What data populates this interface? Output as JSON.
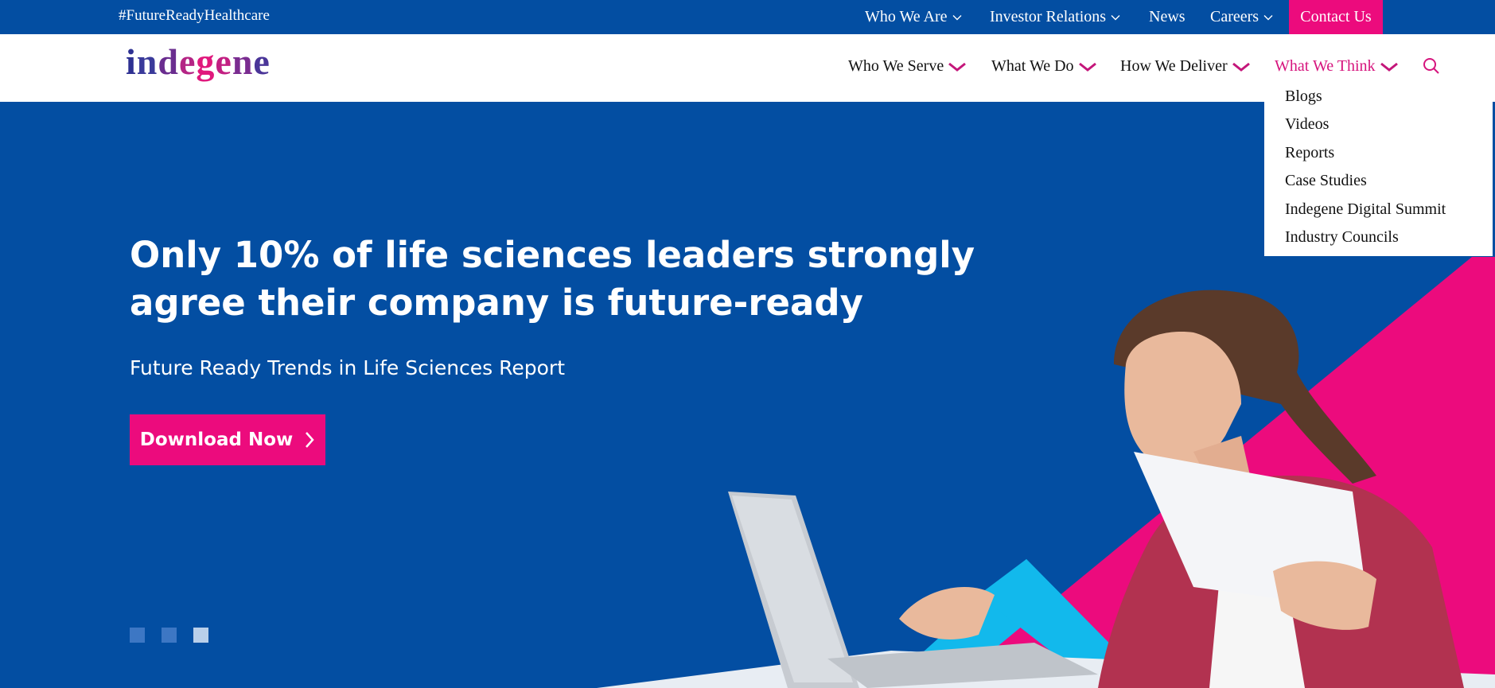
{
  "topbar": {
    "hashtag": "#FutureReadyHealthcare",
    "links": [
      {
        "label": "Who We Are",
        "has_dropdown": true
      },
      {
        "label": "Investor Relations",
        "has_dropdown": true
      },
      {
        "label": "News",
        "has_dropdown": false
      },
      {
        "label": "Careers",
        "has_dropdown": true
      }
    ],
    "contact_label": "Contact Us"
  },
  "header": {
    "logo_text": "indegene",
    "nav": [
      {
        "label": "Who We Serve"
      },
      {
        "label": "What We Do"
      },
      {
        "label": "How We Deliver"
      },
      {
        "label": "What We Think",
        "active": true
      }
    ],
    "search_icon": "search-icon"
  },
  "dropdown": {
    "items": [
      "Blogs",
      "Videos",
      "Reports",
      "Case Studies",
      "Indegene Digital Summit",
      "Industry Councils"
    ]
  },
  "hero": {
    "headline_line1": "Only 10% of life sciences leaders strongly",
    "headline_line2": "agree their company is future-ready",
    "subheadline": "Future Ready Trends in Life Sciences Report",
    "cta_label": "Download Now",
    "slides_total": 3,
    "active_slide": 3
  },
  "colors": {
    "brand_blue": "#034ea2",
    "brand_pink": "#ec0b7d",
    "accent_cyan": "#12b9ec",
    "active_nav": "#d6147d"
  }
}
